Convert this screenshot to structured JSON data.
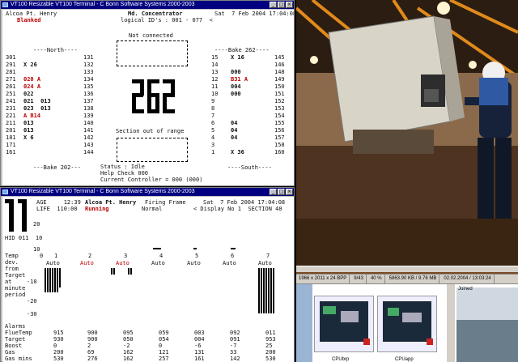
{
  "window_top": {
    "title": "VT100 Resizable VT100 Terminal - C Bonn Software Systems 2000-2003",
    "btn_min": "_",
    "btn_max": "□",
    "btn_close": "×",
    "site": "Alcoa Pt. Henry",
    "state": "Blanked",
    "heading": "Md. Concentrator",
    "logical_ids": "logical ID's : 001 - 077  <",
    "datetime": "Sat  7 Feb 2004 17:04:08",
    "not_connected": "Not connected",
    "north_header": "----North----",
    "bake_header": "----Bake 262----",
    "big_number": "262",
    "section_status": "Section out of range",
    "bake_bottom": "---Bake 202---",
    "south_footer": "----South----",
    "status": "Status : Idle",
    "help": "Help Check 000",
    "current_controller": "Current Controller = 000 (000)",
    "left_rows": [
      {
        "a": "301",
        "b": "",
        "c": "131"
      },
      {
        "a": "291",
        "b": "X 26",
        "c": "132"
      },
      {
        "a": "281",
        "b": "",
        "c": "133"
      },
      {
        "a": "271",
        "b": "020 A",
        "c": "134"
      },
      {
        "a": "261",
        "b": "024 A",
        "c": "135"
      },
      {
        "a": "251",
        "b": "022",
        "c": "136"
      },
      {
        "a": "241",
        "b": "021  013",
        "c": "137"
      },
      {
        "a": "231",
        "b": "023  013",
        "c": "138"
      },
      {
        "a": "221",
        "b": "A B14",
        "c": "139"
      },
      {
        "a": "211",
        "b": "013",
        "c": "140"
      },
      {
        "a": "201",
        "b": "013",
        "c": "141"
      },
      {
        "a": "181",
        "b": "X 6",
        "c": "142"
      },
      {
        "a": "171",
        "b": "",
        "c": "143"
      },
      {
        "a": "161",
        "b": "",
        "c": "144"
      }
    ],
    "right_rows": [
      {
        "a": "15",
        "b": "X 16",
        "c": "145"
      },
      {
        "a": "14",
        "b": "",
        "c": "146"
      },
      {
        "a": "13",
        "b": "000",
        "c": "148"
      },
      {
        "a": "12",
        "b": "B31 A",
        "c": "149"
      },
      {
        "a": "11",
        "b": "004",
        "c": "150"
      },
      {
        "a": "10",
        "b": "000",
        "c": "151"
      },
      {
        "a": "9",
        "b": "",
        "c": "152"
      },
      {
        "a": "8",
        "b": "",
        "c": "153"
      },
      {
        "a": "7",
        "b": "",
        "c": "154"
      },
      {
        "a": "6",
        "b": "04",
        "c": "155"
      },
      {
        "a": "5",
        "b": "04",
        "c": "156"
      },
      {
        "a": "4",
        "b": "04",
        "c": "157"
      },
      {
        "a": "3",
        "b": "",
        "c": "158"
      },
      {
        "a": "1",
        "b": "X 36",
        "c": "160"
      }
    ]
  },
  "window_bottom": {
    "title": "VT100 Resizable VT100 Terminal - C Bonn Software Systems 2000-2003",
    "btn_min": "_",
    "btn_max": "□",
    "btn_close": "×",
    "age": "AGE     12:39",
    "site": "Alcoa Pt. Henry",
    "firing_label": "Firing Frame",
    "datetime": "Sat  7 Feb 2004 17:04:08",
    "life": "LIFE  110:00",
    "running": "Running",
    "mode": "Normal",
    "display": "< Display No 1  SECTION 40",
    "big_number": "11",
    "hid": "HID 011  10",
    "axis_top": "20",
    "axis_mid": "10",
    "axis_low": "-10",
    "axis_bot": "-20",
    "axis_end": "-30",
    "temp_label": "Temp",
    "dev_label": "dev.",
    "from_label": "from",
    "target_label": "Target",
    "at_label": "at",
    "minute_label": "minute",
    "period_label": "period",
    "channels": [
      "0",
      "1",
      "2",
      "3",
      "4",
      "5",
      "6",
      "7"
    ],
    "modes": [
      "Auto",
      "Auto",
      "Auto",
      "Auto",
      "Auto",
      "Auto",
      "Auto"
    ],
    "table": {
      "labels": [
        "Alarms",
        "FlueTemp",
        "Target",
        "Boost",
        "Gas",
        "Gas mins"
      ],
      "rows": [
        [
          "",
          "",
          "",
          "",
          "",
          "",
          ""
        ],
        [
          "915",
          "900",
          "095",
          "059",
          "003",
          "092",
          "011"
        ],
        [
          "930",
          "900",
          "050",
          "054",
          "004",
          "091",
          "953"
        ],
        [
          "0",
          "2",
          "-2",
          "0",
          "-6",
          "-7",
          "25"
        ],
        [
          "200",
          "69",
          "162",
          "121",
          "131",
          "33",
          "200"
        ],
        [
          "530",
          "276",
          "162",
          "257",
          "161",
          "142",
          "530"
        ]
      ]
    }
  },
  "viewer": {
    "status": [
      "1966 x 2011 x 24 BPP",
      "9/43",
      "40 %",
      "5863.90 KB / 9.76 MB",
      "02.02.2004 / 13:03:24"
    ],
    "thumb_folder_label": "Joined",
    "thumb1_label": "CPUbrp",
    "thumb2_label": "CPUapp"
  }
}
